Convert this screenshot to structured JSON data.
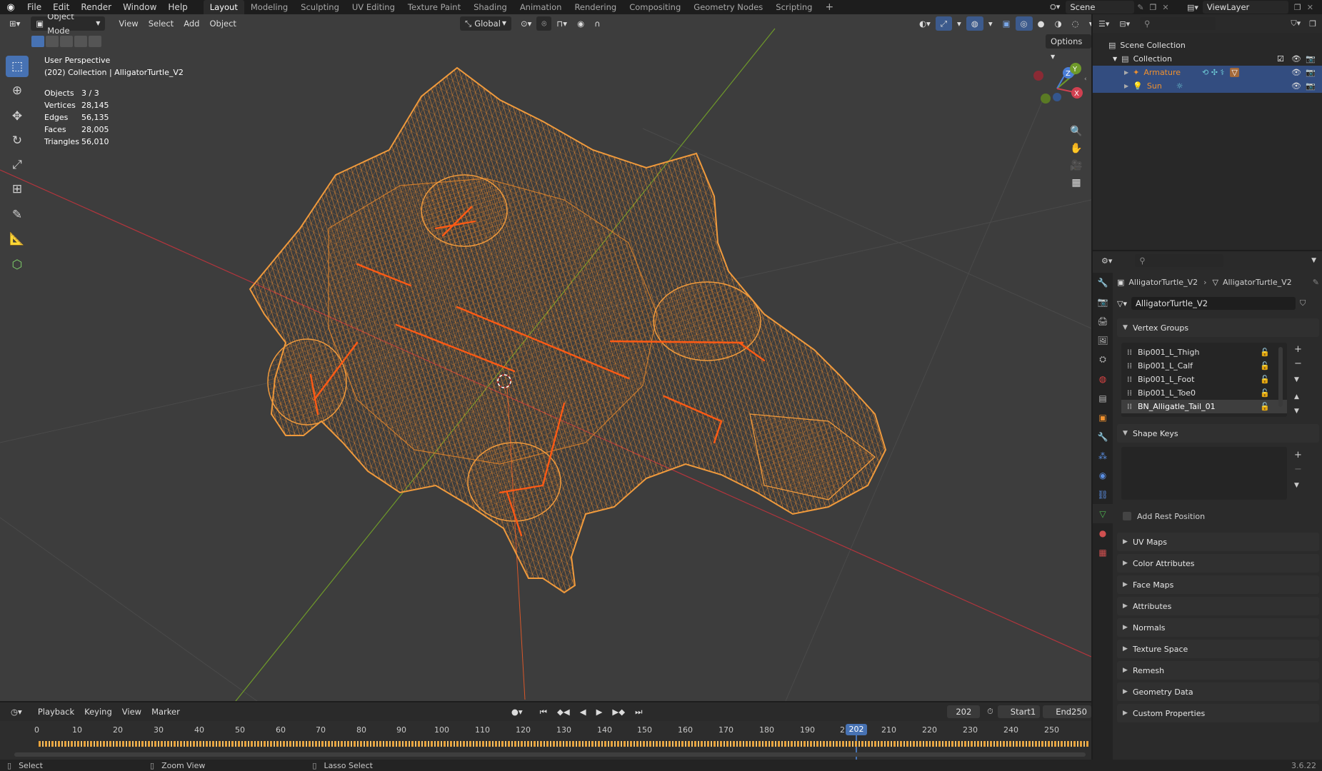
{
  "topbar": {
    "menus": [
      "File",
      "Edit",
      "Render",
      "Window",
      "Help"
    ],
    "workspaces": [
      "Layout",
      "Modeling",
      "Sculpting",
      "UV Editing",
      "Texture Paint",
      "Shading",
      "Animation",
      "Rendering",
      "Compositing",
      "Geometry Nodes",
      "Scripting"
    ],
    "active_workspace": "Layout",
    "scene": "Scene",
    "view_layer": "ViewLayer"
  },
  "viewport": {
    "mode": "Object Mode",
    "menus": [
      "View",
      "Select",
      "Add",
      "Object"
    ],
    "orientation": "Global",
    "options_label": "Options",
    "perspective": "User Perspective",
    "context": "(202) Collection | AlligatorTurtle_V2",
    "stats": [
      {
        "label": "Objects",
        "value": "3 / 3"
      },
      {
        "label": "Vertices",
        "value": "28,145"
      },
      {
        "label": "Edges",
        "value": "56,135"
      },
      {
        "label": "Faces",
        "value": "28,005"
      },
      {
        "label": "Triangles",
        "value": "56,010"
      }
    ],
    "gizmo": {
      "x": "X",
      "y": "Y",
      "z": "Z"
    },
    "colors": {
      "wire": "#e8892e",
      "bones": "#ff5a14",
      "x_axis": "#b3353d",
      "y_axis": "#6f9a2a",
      "bg": "#3d3d3d"
    }
  },
  "outliner": {
    "scene_collection": "Scene Collection",
    "collection": "Collection",
    "items": [
      {
        "name": "Armature",
        "color": "#f0912e"
      },
      {
        "name": "Sun",
        "color": "#f0912e"
      }
    ]
  },
  "properties": {
    "breadcrumb_object": "AlligatorTurtle_V2",
    "breadcrumb_mesh": "AlligatorTurtle_V2",
    "mesh_name": "AlligatorTurtle_V2",
    "vertex_groups_title": "Vertex Groups",
    "vertex_groups": [
      "Bip001_L_Thigh",
      "Bip001_L_Calf",
      "Bip001_L_Foot",
      "Bip001_L_Toe0",
      "BN_Alligatle_Tail_01"
    ],
    "shape_keys_title": "Shape Keys",
    "add_rest_position": "Add Rest Position",
    "panels": [
      "UV Maps",
      "Color Attributes",
      "Face Maps",
      "Attributes",
      "Normals",
      "Texture Space",
      "Remesh",
      "Geometry Data",
      "Custom Properties"
    ]
  },
  "timeline": {
    "menus": [
      "Playback",
      "Keying",
      "View",
      "Marker"
    ],
    "current_frame": "202",
    "start_label": "Start",
    "start": "1",
    "end_label": "End",
    "end": "250",
    "ticks": [
      "0",
      "10",
      "20",
      "30",
      "40",
      "50",
      "60",
      "70",
      "80",
      "90",
      "100",
      "110",
      "120",
      "130",
      "140",
      "150",
      "160",
      "170",
      "180",
      "190",
      "2",
      "202",
      "210",
      "220",
      "230",
      "240",
      "250"
    ]
  },
  "statusbar": {
    "select": "Select",
    "zoom": "Zoom View",
    "lasso": "Lasso Select",
    "version": "3.6.22"
  }
}
